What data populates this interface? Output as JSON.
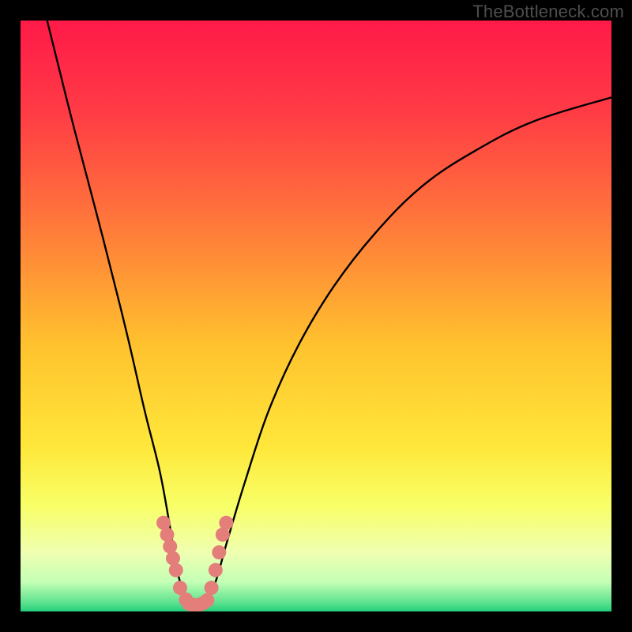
{
  "watermark": "TheBottleneck.com",
  "chart_data": {
    "type": "line",
    "title": "",
    "xlabel": "",
    "ylabel": "",
    "xlim": [
      0,
      100
    ],
    "ylim": [
      0,
      100
    ],
    "grid": false,
    "legend": false,
    "background": {
      "type": "vertical-gradient",
      "stops": [
        {
          "pos": 0.0,
          "color": "#ff1a49"
        },
        {
          "pos": 0.15,
          "color": "#ff3a45"
        },
        {
          "pos": 0.35,
          "color": "#ff7a3a"
        },
        {
          "pos": 0.55,
          "color": "#ffc22e"
        },
        {
          "pos": 0.72,
          "color": "#ffe73a"
        },
        {
          "pos": 0.82,
          "color": "#f8ff66"
        },
        {
          "pos": 0.9,
          "color": "#efffb0"
        },
        {
          "pos": 0.95,
          "color": "#c4ffb5"
        },
        {
          "pos": 0.985,
          "color": "#5de28f"
        },
        {
          "pos": 1.0,
          "color": "#23cf7c"
        }
      ]
    },
    "series": [
      {
        "name": "bottleneck-curve",
        "color": "#000000",
        "x": [
          4.5,
          9,
          14,
          18,
          21,
          23.5,
          25,
          26,
          27,
          28.5,
          30,
          31.5,
          33,
          35,
          38,
          42,
          47,
          53,
          60,
          68,
          77,
          87,
          100
        ],
        "y": [
          100,
          82,
          63,
          47,
          34,
          24,
          16,
          10,
          5,
          2,
          1,
          2,
          5,
          12,
          22,
          34,
          45,
          55,
          64,
          72,
          78,
          83,
          87
        ]
      }
    ],
    "markers": [
      {
        "name": "left-cluster",
        "color": "#e37e7b",
        "points": [
          {
            "x": 24.2,
            "y": 15
          },
          {
            "x": 24.8,
            "y": 13
          },
          {
            "x": 25.3,
            "y": 11
          },
          {
            "x": 25.8,
            "y": 9
          },
          {
            "x": 26.3,
            "y": 7
          },
          {
            "x": 27.0,
            "y": 4
          },
          {
            "x": 28.0,
            "y": 2
          }
        ]
      },
      {
        "name": "bottom-cluster",
        "color": "#e37e7b",
        "points": [
          {
            "x": 28.5,
            "y": 1.3
          },
          {
            "x": 29.3,
            "y": 1.1
          },
          {
            "x": 30.1,
            "y": 1.1
          },
          {
            "x": 30.9,
            "y": 1.4
          },
          {
            "x": 31.6,
            "y": 1.9
          }
        ]
      },
      {
        "name": "right-cluster",
        "color": "#e37e7b",
        "points": [
          {
            "x": 32.3,
            "y": 4
          },
          {
            "x": 33.0,
            "y": 7
          },
          {
            "x": 33.6,
            "y": 10
          },
          {
            "x": 34.2,
            "y": 13
          },
          {
            "x": 34.8,
            "y": 15
          }
        ]
      }
    ]
  }
}
